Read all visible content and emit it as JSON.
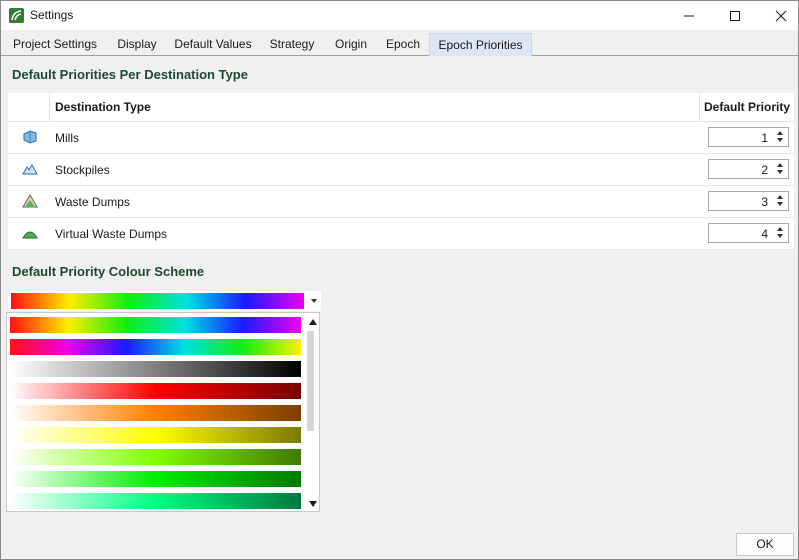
{
  "window": {
    "title": "Settings",
    "icon": "settings-app-icon",
    "controls": [
      "minimize-icon",
      "maximize-icon",
      "close-icon"
    ]
  },
  "tabs": [
    {
      "label": "Project Settings"
    },
    {
      "label": "Display"
    },
    {
      "label": "Default Values"
    },
    {
      "label": "Strategy"
    },
    {
      "label": "Origin"
    },
    {
      "label": "Epoch"
    },
    {
      "label": "Epoch Priorities",
      "active": true
    }
  ],
  "priorities": {
    "title": "Default Priorities Per Destination Type",
    "columns": {
      "type": "Destination Type",
      "priority": "Default Priority"
    },
    "rows": [
      {
        "label": "Mills",
        "icon": "mill-icon",
        "priority": "1"
      },
      {
        "label": "Stockpiles",
        "icon": "stockpile-icon",
        "priority": "2"
      },
      {
        "label": "Waste Dumps",
        "icon": "waste-dump-icon",
        "priority": "3"
      },
      {
        "label": "Virtual Waste Dumps",
        "icon": "virtual-waste-dump-icon",
        "priority": "4"
      }
    ]
  },
  "colour_scheme": {
    "title": "Default Priority Colour Scheme",
    "selected_index": 0,
    "options": [
      [
        "#ff1010",
        "#ffee00",
        "#11ee11",
        "#00e0e0",
        "#1a1aff",
        "#ee00ee"
      ],
      [
        "#ff1010",
        "#ee00ee",
        "#1a1aff",
        "#00e0e0",
        "#11ee11",
        "#ffee00"
      ],
      [
        "#ffffff",
        "#000000"
      ],
      [
        "#ffffff",
        "#ff0000",
        "#7a0000"
      ],
      [
        "#ffffff",
        "#ff8000",
        "#7a3f00"
      ],
      [
        "#ffffff",
        "#ffff00",
        "#7a7a00"
      ],
      [
        "#ffffff",
        "#80ff00",
        "#3f7a00"
      ],
      [
        "#ffffff",
        "#00ee00",
        "#007a00"
      ],
      [
        "#ffffff",
        "#00ff80",
        "#007a3f"
      ]
    ]
  },
  "footer": {
    "ok_label": "OK"
  },
  "colors": {
    "heading": "#1d4a2e",
    "tab_active": "#dce6f4",
    "brand": "#2e7d32"
  }
}
